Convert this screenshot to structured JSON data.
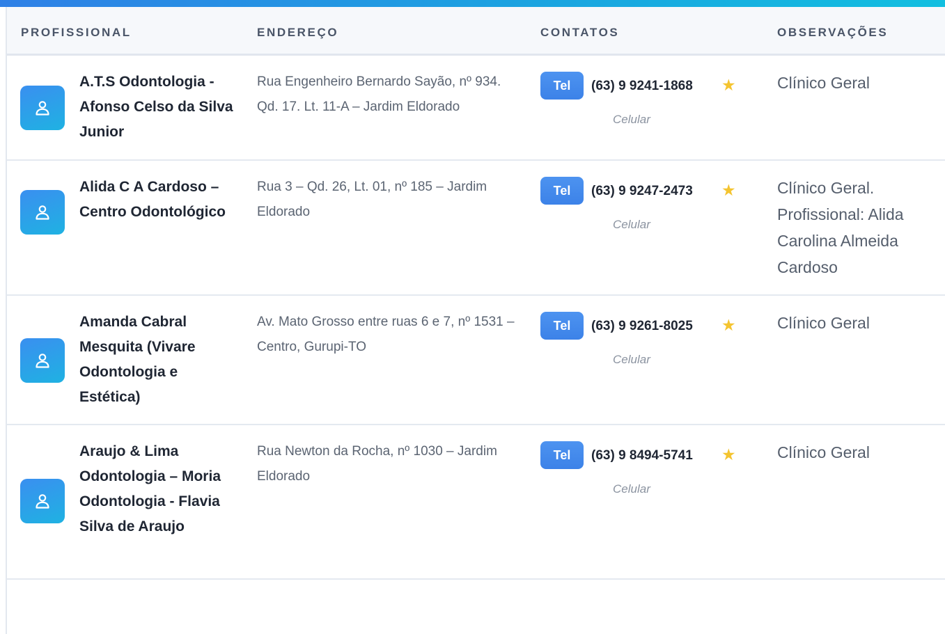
{
  "table": {
    "headers": {
      "professional": "PROFISSIONAL",
      "address": "ENDEREÇO",
      "contacts": "CONTATOS",
      "notes": "OBSERVAÇÕES"
    },
    "rows": [
      {
        "name": "A.T.S Odontologia - Afonso Celso da Silva Junior",
        "address": "Rua Engenheiro Bernardo Sayão, nº 934. Qd. 17. Lt. 11-A – Jardim Eldorado",
        "phone_badge": "Tel",
        "phone": "(63) 9 9241-1868",
        "phone_type": "Celular",
        "featured": true,
        "notes": "Clínico Geral"
      },
      {
        "name": "Alida C A Cardoso – Centro Odontológico",
        "address": "Rua 3 – Qd. 26, Lt. 01, nº 185 – Jardim Eldorado",
        "phone_badge": "Tel",
        "phone": "(63) 9 9247-2473",
        "phone_type": "Celular",
        "featured": true,
        "notes": "Clínico Geral. Profissional: Alida Carolina Almeida Cardoso"
      },
      {
        "name": "Amanda Cabral Mesquita (Vivare Odontologia e Estética)",
        "address": "Av. Mato Grosso entre ruas 6 e 7, nº 1531 – Centro, Gurupi-TO",
        "phone_badge": "Tel",
        "phone": "(63) 9 9261-8025",
        "phone_type": "Celular",
        "featured": true,
        "notes": "Clínico Geral"
      },
      {
        "name": "Araujo & Lima Odontologia – Moria Odontologia - Flavia Silva de Araujo",
        "address": "Rua Newton da Rocha, nº 1030 – Jardim Eldorado",
        "phone_badge": "Tel",
        "phone": "(63) 9 8494-5741",
        "phone_type": "Celular",
        "featured": true,
        "notes": "Clínico Geral"
      }
    ]
  },
  "icons": {
    "avatar": "user-icon",
    "featured": "star-icon"
  },
  "colors": {
    "accent_gradient_start": "#2f80e6",
    "accent_gradient_end": "#12bfe0",
    "badge": "#4d93f0",
    "star": "#f4c430"
  }
}
